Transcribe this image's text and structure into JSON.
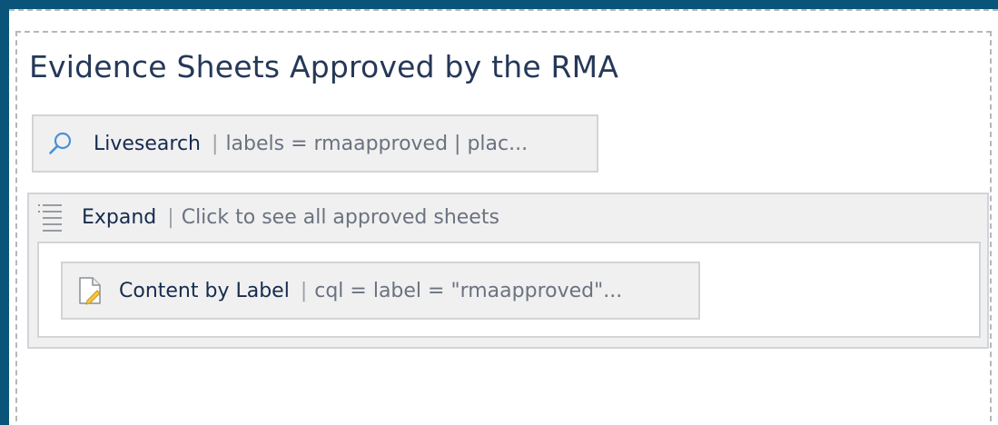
{
  "page": {
    "title": "Evidence Sheets Approved by the RMA"
  },
  "macros": {
    "livesearch": {
      "icon": "search-icon",
      "name": "Livesearch",
      "separator": "|",
      "params": "labels = rmaapproved | plac..."
    },
    "expand": {
      "icon": "list-icon",
      "name": "Expand",
      "separator": "|",
      "params": "Click to see all approved sheets"
    },
    "content_by_label": {
      "icon": "document-icon",
      "name": "Content by Label",
      "separator": "|",
      "params": "cql = label = \"rmaapproved\"..."
    }
  },
  "colors": {
    "background": "#0b5479",
    "macro_fill": "#f0f0f0",
    "macro_border": "#d2d4d7",
    "search_icon": "#4a90d9"
  }
}
